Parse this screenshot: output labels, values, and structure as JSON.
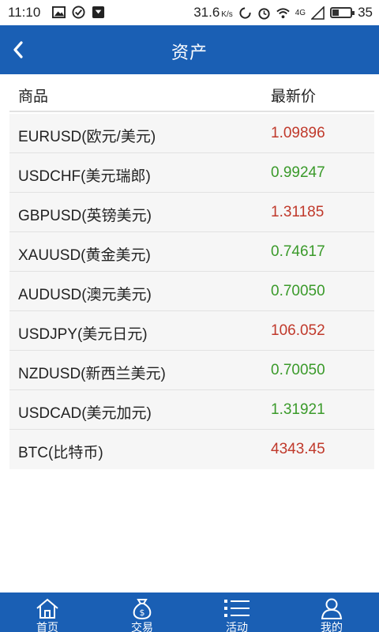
{
  "status_bar": {
    "time": "11:10",
    "speed_value": "31.6",
    "speed_unit": "K/s",
    "network": "4G",
    "battery": "35",
    "battery_fraction": 0.35
  },
  "nav": {
    "title": "资产"
  },
  "table": {
    "headers": {
      "name": "商品",
      "price": "最新价"
    },
    "rows": [
      {
        "name": "EURUSD(欧元/美元)",
        "price": "1.09896",
        "trend": "down"
      },
      {
        "name": "USDCHF(美元瑞郎)",
        "price": "0.99247",
        "trend": "up"
      },
      {
        "name": "GBPUSD(英镑美元)",
        "price": "1.31185",
        "trend": "down"
      },
      {
        "name": "XAUUSD(黄金美元)",
        "price": "0.74617",
        "trend": "up"
      },
      {
        "name": "AUDUSD(澳元美元)",
        "price": "0.70050",
        "trend": "up"
      },
      {
        "name": "USDJPY(美元日元)",
        "price": "106.052",
        "trend": "down"
      },
      {
        "name": "NZDUSD(新西兰美元)",
        "price": "0.70050",
        "trend": "up"
      },
      {
        "name": "USDCAD(美元加元)",
        "price": "1.31921",
        "trend": "up"
      },
      {
        "name": "BTC(比特币)",
        "price": "4343.45",
        "trend": "down"
      }
    ]
  },
  "colors": {
    "primary": "#1a5fb4",
    "down": "#c0392b",
    "up": "#3a9a2a"
  },
  "tabbar": [
    {
      "label": "首页",
      "icon": "home-icon"
    },
    {
      "label": "交易",
      "icon": "money-bag-icon"
    },
    {
      "label": "活动",
      "icon": "list-icon"
    },
    {
      "label": "我的",
      "icon": "user-icon"
    }
  ]
}
